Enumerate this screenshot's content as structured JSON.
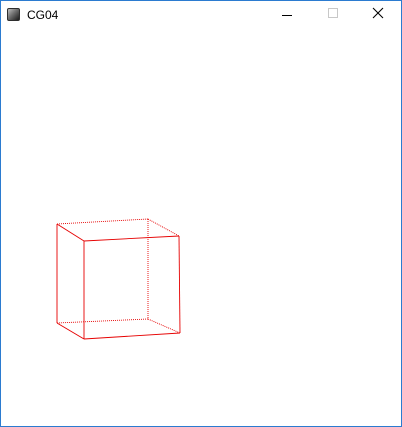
{
  "window": {
    "title": "CG04",
    "icon": "app-window-icon",
    "controls": [
      "minimize-icon",
      "maximize-icon",
      "close-icon"
    ]
  },
  "scene": {
    "object": "wireframe-cube",
    "stroke_color": "#e60000",
    "background": "#ffffff",
    "accent_border": "#2b7bd0"
  }
}
